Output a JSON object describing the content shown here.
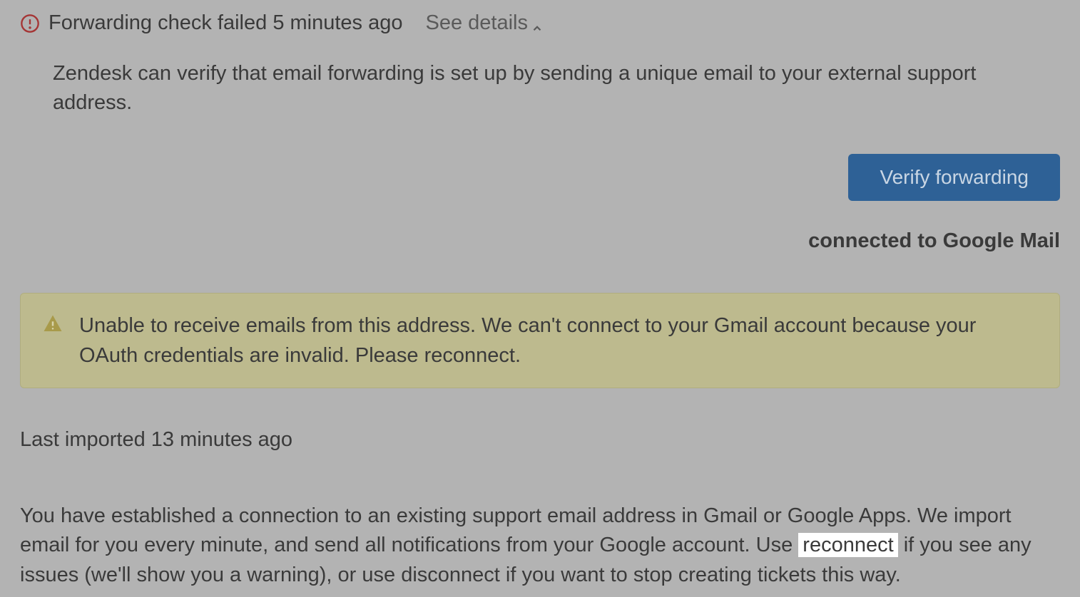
{
  "header": {
    "status_text": "Forwarding check failed 5 minutes ago",
    "see_details_label": "See details"
  },
  "description": "Zendesk can verify that email forwarding is set up by sending a unique email to your external support address.",
  "verify_button_label": "Verify forwarding",
  "connected_label": "connected to Google Mail",
  "warning": {
    "message": "Unable to receive emails from this address. We can't connect to your Gmail account because your OAuth credentials are invalid. Please reconnect."
  },
  "last_imported": "Last imported 13 minutes ago",
  "connection_info": {
    "part1": "You have established a connection to an existing support email address in Gmail or Google Apps. We import email for you every minute, and send all notifications from your Google account. Use ",
    "highlighted": "reconnect",
    "part2": " if you see any issues (we'll show you a warning), or use disconnect if you want to stop creating tickets this way."
  },
  "colors": {
    "accent_button": "#2e6196",
    "warning_bg": "#bdba8e",
    "alert_red": "#a53535"
  }
}
